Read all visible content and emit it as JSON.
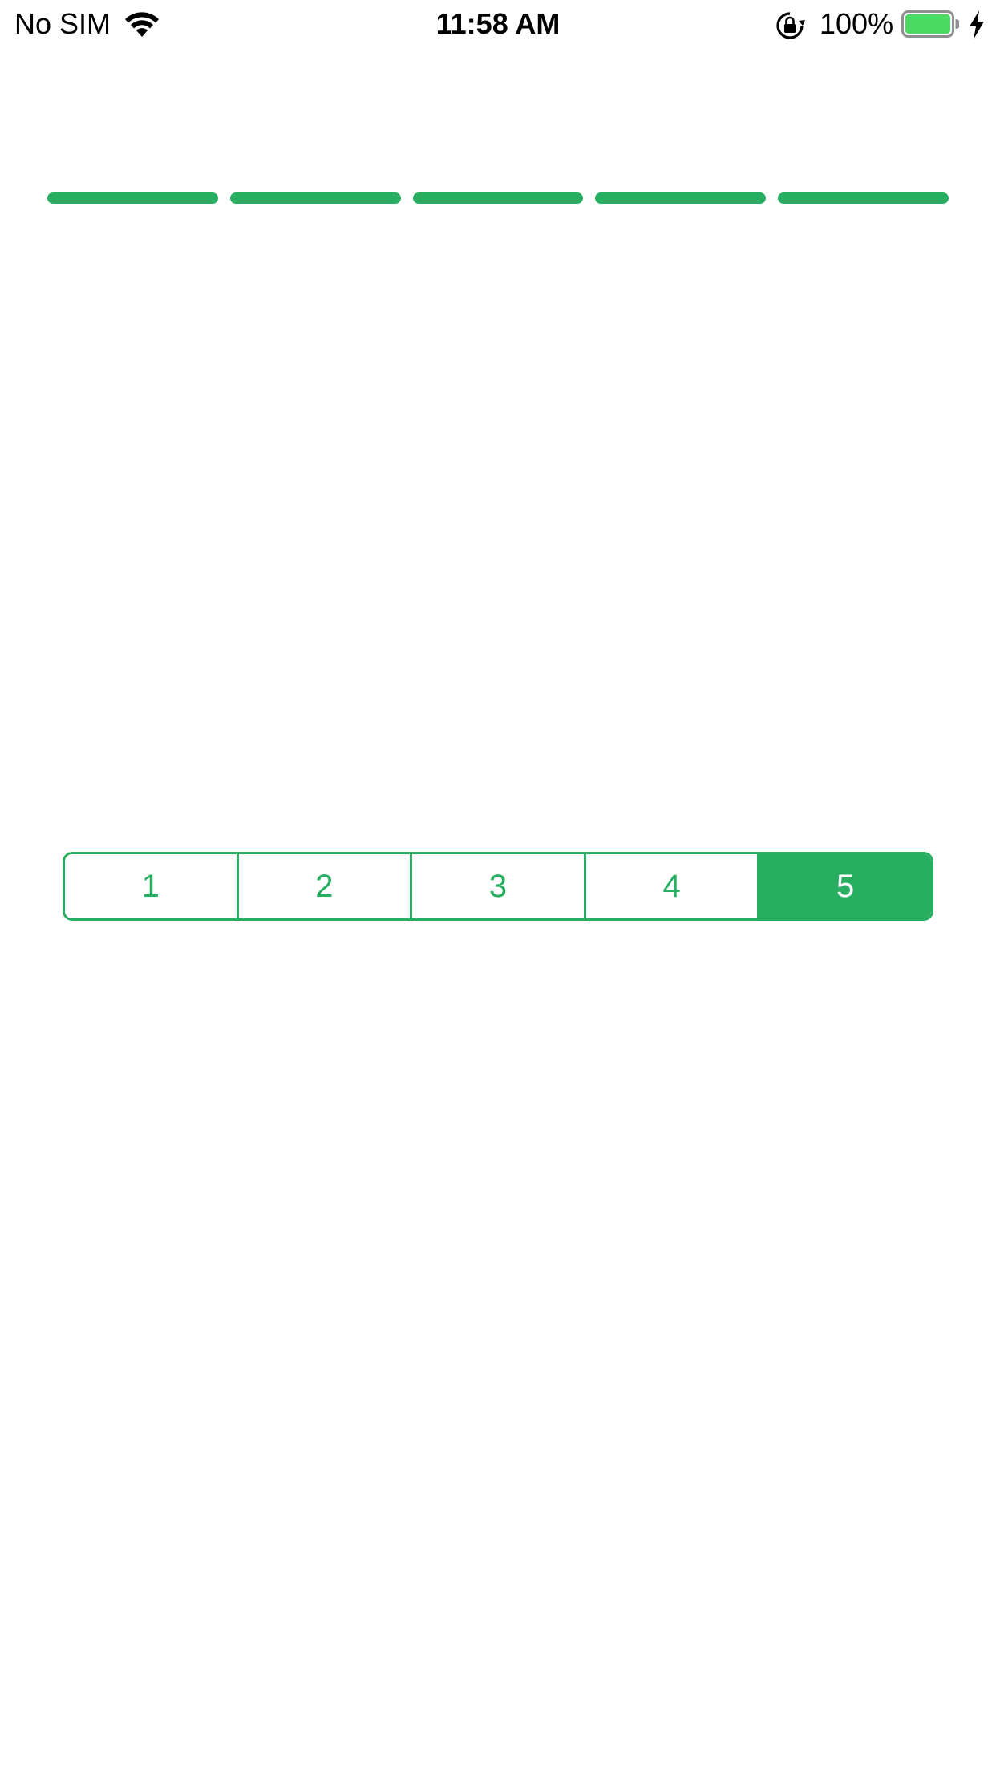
{
  "status_bar": {
    "carrier": "No SIM",
    "time": "11:58 AM",
    "battery_percent": "100%",
    "wifi_icon": "wifi-icon",
    "orientation_lock_icon": "orientation-lock-icon",
    "battery_icon": "battery-icon",
    "charging_icon": "charging-bolt-icon",
    "battery_level": 1.0
  },
  "progress": {
    "segments": 5,
    "filled": [
      1.0,
      1.0,
      1.0,
      1.0,
      1.0
    ]
  },
  "segmented_control": {
    "options": [
      "1",
      "2",
      "3",
      "4",
      "5"
    ],
    "selected": "5"
  },
  "colors": {
    "accent": "#27ae60",
    "battery_fill": "#4cd964",
    "background": "#ffffff"
  }
}
